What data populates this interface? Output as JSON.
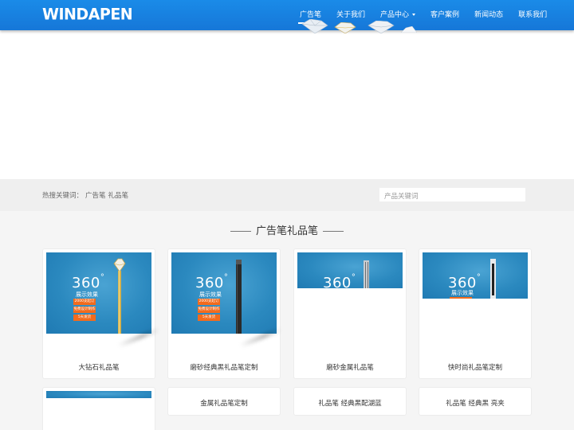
{
  "header": {
    "logo": "WINDAPEN",
    "nav": [
      {
        "label": "广告笔",
        "active": true
      },
      {
        "label": "关于我们"
      },
      {
        "label": "产品中心",
        "has_dropdown": true
      },
      {
        "label": "客户案例"
      },
      {
        "label": "新闻动态"
      },
      {
        "label": "联系我们"
      }
    ]
  },
  "search": {
    "hot_label": "热搜关键词：",
    "hot_keywords": [
      "广告笔",
      "礼品笔"
    ],
    "placeholder": "产品关键词"
  },
  "section": {
    "title": "广告笔礼品笔"
  },
  "promo": {
    "big": "360",
    "sub": "展示效果",
    "badges": [
      "2000支起订",
      "免费设计制作",
      "5天发货"
    ]
  },
  "products": [
    {
      "name": "大钻石礼品笔",
      "pen": "gold-diamond"
    },
    {
      "name": "磨砂经典黑礼品笔定制",
      "pen": "black"
    },
    {
      "name": "磨砂金属礼品笔",
      "pen": "silver"
    },
    {
      "name": "快时尚礼品笔定制",
      "pen": "white-black"
    },
    {
      "name": ""
    },
    {
      "name": "金属礼品笔定制"
    },
    {
      "name": "礼品笔 经典黑配湖蓝"
    },
    {
      "name": "礼品笔 经典黑 亮夹"
    }
  ],
  "colors": {
    "header_blue": "#1a8be8",
    "promo_orange": "#f26b1d",
    "thumb_blue": "#2b89bf"
  }
}
